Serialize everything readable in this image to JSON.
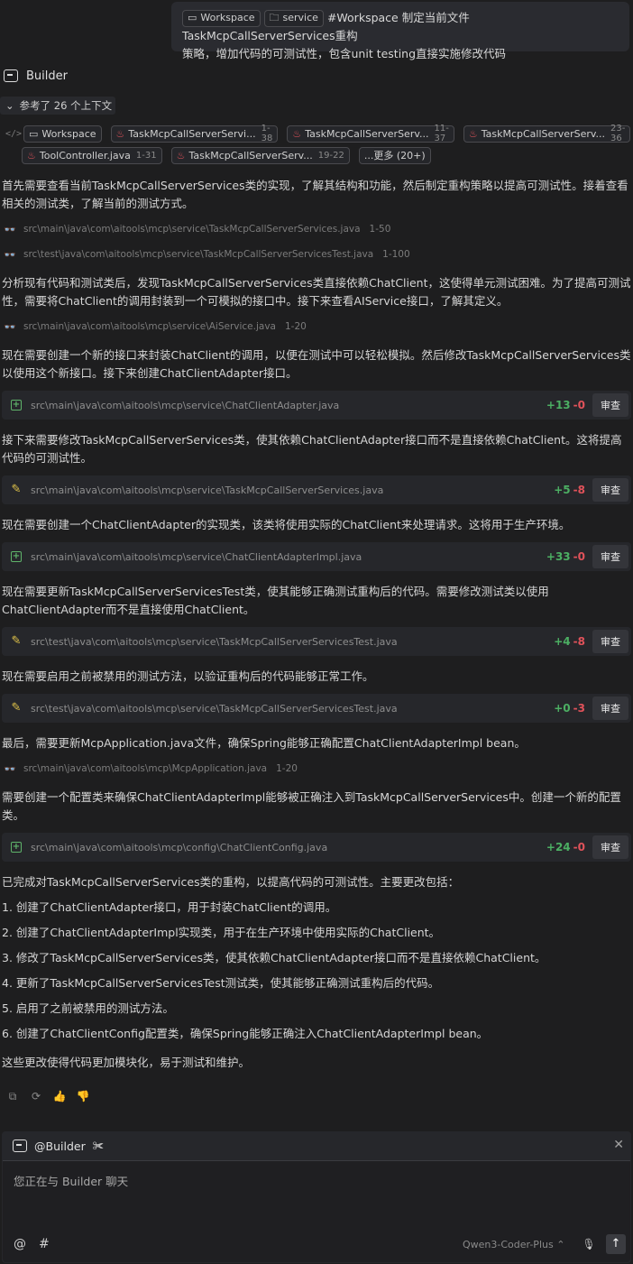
{
  "user_message": {
    "chip_workspace": "Workspace",
    "chip_service": "service",
    "text_line1": "#Workspace 制定当前文件TaskMcpCallServerServices重构",
    "text_line2": "策略，增加代码的可测试性，包含unit testing直接实施修改代码"
  },
  "assistant": {
    "name": "Builder",
    "context_toggle": "参考了 26 个上下文",
    "context_chips": [
      {
        "label": "Workspace",
        "range": ""
      },
      {
        "label": "TaskMcpCallServerServi...",
        "range": "1-38"
      },
      {
        "label": "TaskMcpCallServerServ...",
        "range": "11-37"
      },
      {
        "label": "TaskMcpCallServerServ...",
        "range": "23-36"
      },
      {
        "label": "ToolController.java",
        "range": "1-31"
      },
      {
        "label": "TaskMcpCallServerServ...",
        "range": "19-22"
      },
      {
        "label": "...更多 (20+)",
        "range": ""
      }
    ],
    "paragraphs": [
      "首先需要查看当前TaskMcpCallServerServices类的实现，了解其结构和功能，然后制定重构策略以提高可测试性。接着查看相关的测试类，了解当前的测试方式。",
      "分析现有代码和测试类后，发现TaskMcpCallServerServices类直接依赖ChatClient，这使得单元测试困难。为了提高可测试性，需要将ChatClient的调用封装到一个可模拟的接口中。接下来查看AIService接口，了解其定义。",
      "现在需要创建一个新的接口来封装ChatClient的调用，以便在测试中可以轻松模拟。然后修改TaskMcpCallServerServices类以使用这个新接口。接下来创建ChatClientAdapter接口。",
      "接下来需要修改TaskMcpCallServerServices类，使其依赖ChatClientAdapter接口而不是直接依赖ChatClient。这将提高代码的可测试性。",
      "现在需要创建一个ChatClientAdapter的实现类，该类将使用实际的ChatClient来处理请求。这将用于生产环境。",
      "现在需要更新TaskMcpCallServerServicesTest类，使其能够正确测试重构后的代码。需要修改测试类以使用ChatClientAdapter而不是直接使用ChatClient。",
      "现在需要启用之前被禁用的测试方法，以验证重构后的代码能够正常工作。",
      "最后，需要更新McpApplication.java文件，确保Spring能够正确配置ChatClientAdapterImpl bean。",
      "需要创建一个配置类来确保ChatClientAdapterImpl能够被正确注入到TaskMcpCallServerServices中。创建一个新的配置类。",
      "已完成对TaskMcpCallServerServices类的重构，以提高代码的可测试性。主要更改包括：",
      "这些更改使得代码更加模块化，易于测试和维护。"
    ],
    "reads": [
      {
        "path": "src\\main\\java\\com\\aitools\\mcp\\service\\TaskMcpCallServerServices.java",
        "range": "1-50"
      },
      {
        "path": "src\\test\\java\\com\\aitools\\mcp\\service\\TaskMcpCallServerServicesTest.java",
        "range": "1-100"
      },
      {
        "path": "src\\main\\java\\com\\aitools\\mcp\\service\\AiService.java",
        "range": "1-20"
      },
      {
        "path": "src\\main\\java\\com\\aitools\\mcp\\McpApplication.java",
        "range": "1-20"
      }
    ],
    "file_changes": [
      {
        "path": "src\\main\\java\\com\\aitools\\mcp\\service\\ChatClientAdapter.java",
        "added": "+13",
        "removed": "-0",
        "kind": "new"
      },
      {
        "path": "src\\main\\java\\com\\aitools\\mcp\\service\\TaskMcpCallServerServices.java",
        "added": "+5",
        "removed": "-8",
        "kind": "edit"
      },
      {
        "path": "src\\main\\java\\com\\aitools\\mcp\\service\\ChatClientAdapterImpl.java",
        "added": "+33",
        "removed": "-0",
        "kind": "new"
      },
      {
        "path": "src\\test\\java\\com\\aitools\\mcp\\service\\TaskMcpCallServerServicesTest.java",
        "added": "+4",
        "removed": "-8",
        "kind": "edit"
      },
      {
        "path": "src\\test\\java\\com\\aitools\\mcp\\service\\TaskMcpCallServerServicesTest.java",
        "added": "+0",
        "removed": "-3",
        "kind": "edit"
      },
      {
        "path": "src\\main\\java\\com\\aitools\\mcp\\config\\ChatClientConfig.java",
        "added": "+24",
        "removed": "-0",
        "kind": "new"
      }
    ],
    "review_label": "审查",
    "summary_items": [
      "1. 创建了ChatClientAdapter接口，用于封装ChatClient的调用。",
      "2. 创建了ChatClientAdapterImpl实现类，用于在生产环境中使用实际的ChatClient。",
      "3. 修改了TaskMcpCallServerServices类，使其依赖ChatClientAdapter接口而不是直接依赖ChatClient。",
      "4. 更新了TaskMcpCallServerServicesTest测试类，使其能够正确测试重构后的代码。",
      "5. 启用了之前被禁用的测试方法。",
      "6. 创建了ChatClientConfig配置类，确保Spring能够正确注入ChatClientAdapterImpl bean。"
    ]
  },
  "composer": {
    "agent": "@Builder",
    "placeholder": "您正在与 Builder 聊天",
    "at_symbol": "@",
    "hash_symbol": "#",
    "model": "Qwen3-Coder-Plus"
  }
}
